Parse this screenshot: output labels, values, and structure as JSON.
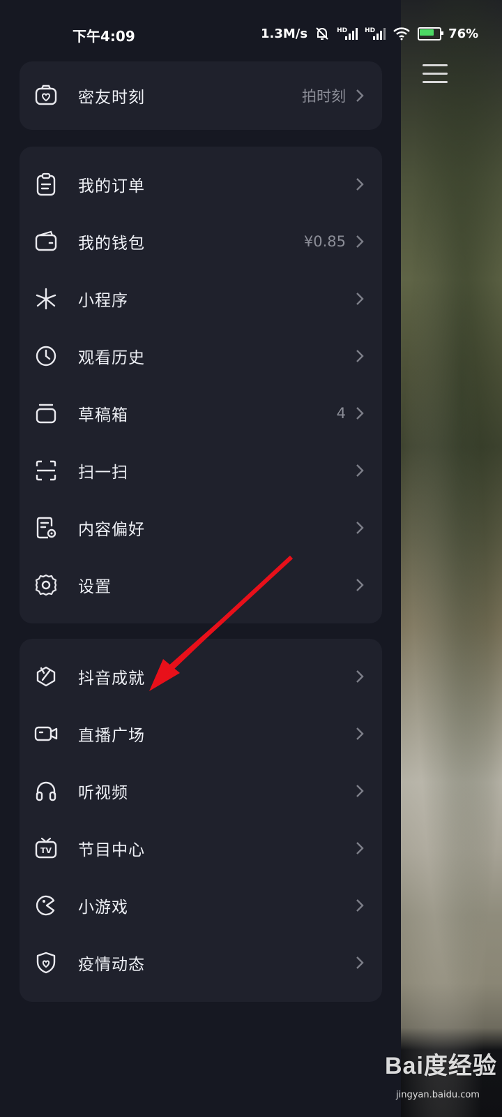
{
  "status_bar": {
    "time": "下午4:09",
    "net_speed": "1.3M/s",
    "hd1": "HD",
    "hd2": "HD",
    "battery": "76%"
  },
  "menu": {
    "card1": [
      {
        "label": "密友时刻",
        "value": "拍时刻",
        "icon": "camera-heart-icon"
      }
    ],
    "card2": [
      {
        "label": "我的订单",
        "value": "",
        "icon": "clipboard-icon"
      },
      {
        "label": "我的钱包",
        "value": "¥0.85",
        "icon": "wallet-icon"
      },
      {
        "label": "小程序",
        "value": "",
        "icon": "asterisk-icon"
      },
      {
        "label": "观看历史",
        "value": "",
        "icon": "clock-icon"
      },
      {
        "label": "草稿箱",
        "value": "4",
        "icon": "drafts-box-icon"
      },
      {
        "label": "扫一扫",
        "value": "",
        "icon": "scan-icon"
      },
      {
        "label": "内容偏好",
        "value": "",
        "icon": "document-settings-icon"
      },
      {
        "label": "设置",
        "value": "",
        "icon": "gear-icon"
      }
    ],
    "card3": [
      {
        "label": "抖音成就",
        "value": "",
        "icon": "achievement-icon"
      },
      {
        "label": "直播广场",
        "value": "",
        "icon": "video-camera-icon"
      },
      {
        "label": "听视频",
        "value": "",
        "icon": "headphones-icon"
      },
      {
        "label": "节目中心",
        "value": "",
        "icon": "tv-icon"
      },
      {
        "label": "小游戏",
        "value": "",
        "icon": "game-icon"
      },
      {
        "label": "疫情动态",
        "value": "",
        "icon": "shield-heart-icon"
      }
    ]
  },
  "watermark": {
    "brand": "Bai度经验",
    "url": "jingyan.baidu.com"
  }
}
